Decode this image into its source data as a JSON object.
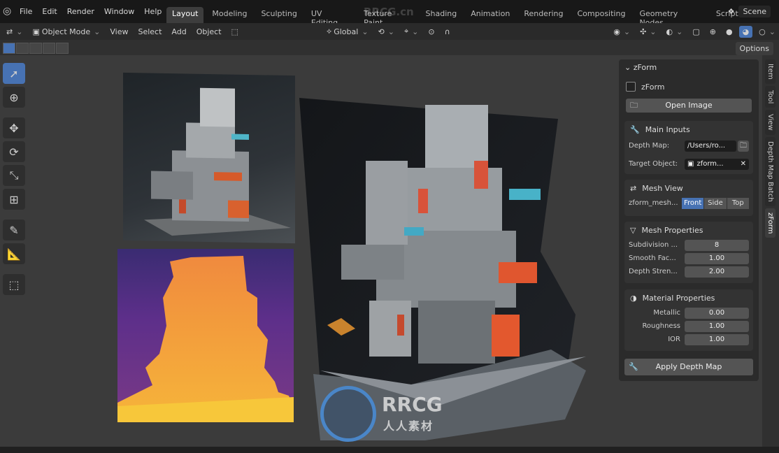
{
  "menu": {
    "items": [
      "File",
      "Edit",
      "Render",
      "Window",
      "Help"
    ]
  },
  "workspaces": [
    "Layout",
    "Modeling",
    "Sculpting",
    "UV Editing",
    "Texture Paint",
    "Shading",
    "Animation",
    "Rendering",
    "Compositing",
    "Geometry Nodes",
    "Scripting"
  ],
  "active_workspace": "Layout",
  "scene_label": "Scene",
  "header": {
    "mode": "Object Mode",
    "view": "View",
    "select": "Select",
    "add": "Add",
    "object": "Object",
    "orientation": "Global"
  },
  "options_label": "Options",
  "watermark": {
    "top": "RRCG.cn",
    "brand": "RRCG",
    "sub": "人人素材"
  },
  "panel": {
    "title": "zForm",
    "checkbox_label": "zForm",
    "open_image": "Open Image",
    "main_inputs": {
      "title": "Main Inputs",
      "depth_label": "Depth Map:",
      "depth_value": "/Users/ro...",
      "target_label": "Target Object:",
      "target_value": "zform..."
    },
    "mesh_view": {
      "title": "Mesh View",
      "label": "zform_mesh...",
      "options": [
        "Front",
        "Side",
        "Top"
      ],
      "selected": "Front"
    },
    "mesh_props": {
      "title": "Mesh Properties",
      "rows": [
        {
          "label": "Subdivision ...",
          "value": "8"
        },
        {
          "label": "Smooth Fac...",
          "value": "1.00"
        },
        {
          "label": "Depth Stren...",
          "value": "2.00"
        }
      ]
    },
    "material_props": {
      "title": "Material Properties",
      "rows": [
        {
          "label": "Metallic",
          "value": "0.00"
        },
        {
          "label": "Roughness",
          "value": "1.00"
        },
        {
          "label": "IOR",
          "value": "1.00"
        }
      ]
    },
    "apply": "Apply Depth Map"
  },
  "side_tabs": [
    "Item",
    "Tool",
    "View",
    "Depth Map Batch",
    "zForm"
  ],
  "active_side_tab": "zForm"
}
